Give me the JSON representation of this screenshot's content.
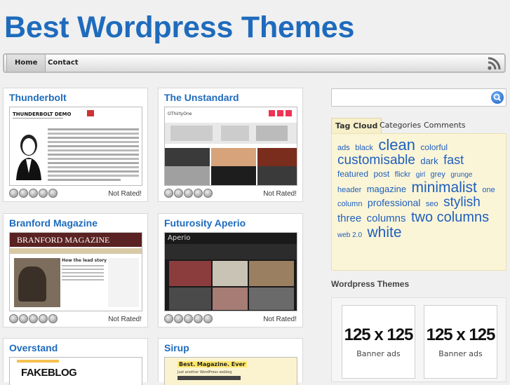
{
  "site": {
    "title": "Best Wordpress Themes"
  },
  "nav": {
    "home": "Home",
    "contact": "Contact"
  },
  "themes": [
    {
      "name": "Thunderbolt",
      "rating": "Not Rated!",
      "thumb_header": "THUNDERBOLT DEMO"
    },
    {
      "name": "The Unstandard",
      "rating": "Not Rated!",
      "thumb_header": "OThirtyOne"
    },
    {
      "name": "Branford Magazine",
      "rating": "Not Rated!",
      "thumb_header": "BRANFORD MAGAZINE",
      "thumb_sub": "How the lead story works"
    },
    {
      "name": "Futurosity Aperio",
      "rating": "Not Rated!",
      "thumb_header": "Aperio"
    },
    {
      "name": "Overstand",
      "thumb_header": "FAKEBLOG"
    },
    {
      "name": "Sirup",
      "thumb_header": "Best. Magazine. Ever",
      "thumb_sub": "Just another WordPress weblog"
    }
  ],
  "sidebar": {
    "tabs": [
      "Tag Cloud",
      "Categories",
      "Comments"
    ],
    "tags": [
      {
        "t": "ads",
        "s": 11
      },
      {
        "t": "black",
        "s": 11
      },
      {
        "t": "clean",
        "s": 22
      },
      {
        "t": "colorful",
        "s": 12
      },
      {
        "t": "customisable",
        "s": 19
      },
      {
        "t": "dark",
        "s": 13
      },
      {
        "t": "fast",
        "s": 18
      },
      {
        "t": "featured",
        "s": 12
      },
      {
        "t": "post",
        "s": 12
      },
      {
        "t": "flickr",
        "s": 11
      },
      {
        "t": "girl",
        "s": 10
      },
      {
        "t": "grey",
        "s": 11
      },
      {
        "t": "grunge",
        "s": 10
      },
      {
        "t": "header",
        "s": 11
      },
      {
        "t": "magazine",
        "s": 13
      },
      {
        "t": "minimalist",
        "s": 21
      },
      {
        "t": "one column",
        "s": 11
      },
      {
        "t": "professional",
        "s": 14
      },
      {
        "t": "seo",
        "s": 11
      },
      {
        "t": "stylish",
        "s": 19
      },
      {
        "t": "three",
        "s": 15
      },
      {
        "t": "columns",
        "s": 15
      },
      {
        "t": "two columns",
        "s": 20
      },
      {
        "t": "web 2.0",
        "s": 10
      },
      {
        "t": "white",
        "s": 21
      }
    ],
    "widget_title": "Wordpress Themes",
    "ads": [
      {
        "size": "125 x 125",
        "label": "Banner ads"
      },
      {
        "size": "125 x 125",
        "label": "Banner ads"
      }
    ]
  }
}
